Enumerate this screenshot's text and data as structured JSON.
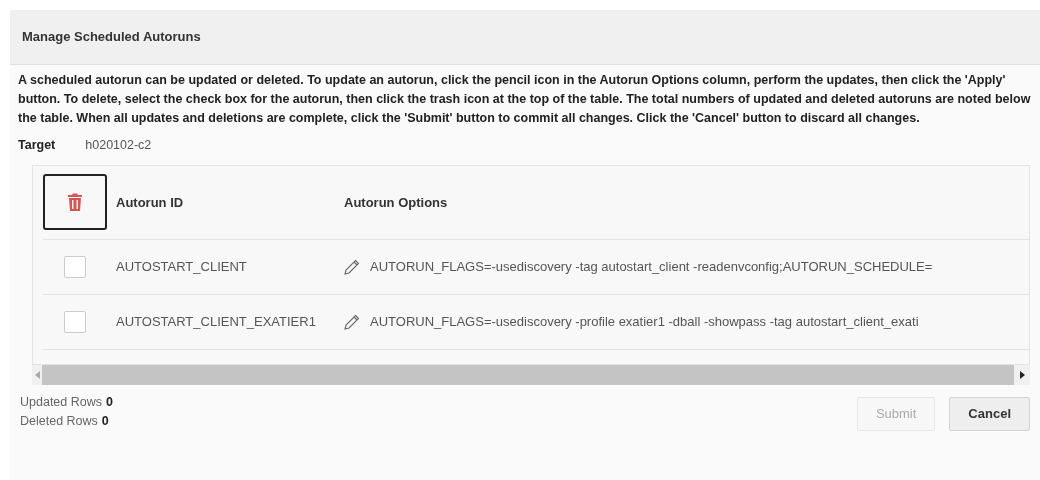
{
  "dialog": {
    "title": "Manage Scheduled Autoruns"
  },
  "instructions": "A scheduled autorun can be updated or deleted. To update an autorun, click the pencil icon in the Autorun Options column, perform the updates, then click the 'Apply' button. To delete, select the check box for the autorun, then click the trash icon at the top of the table. The total numbers of updated and deleted autoruns are noted below the table. When all updates and deletions are complete, click the 'Submit' button to commit all changes. Click the 'Cancel' button to discard all changes.",
  "target": {
    "label": "Target",
    "value": "h020102-c2"
  },
  "table": {
    "columns": [
      "Autorun ID",
      "Autorun Options"
    ],
    "rows": [
      {
        "checked": false,
        "id": "AUTOSTART_CLIENT",
        "options": "AUTORUN_FLAGS=-usediscovery -tag autostart_client -readenvconfig;AUTORUN_SCHEDULE="
      },
      {
        "checked": false,
        "id": "AUTOSTART_CLIENT_EXATIER1",
        "options": "AUTORUN_FLAGS=-usediscovery -profile exatier1 -dball -showpass -tag autostart_client_exati"
      }
    ]
  },
  "summary": [
    {
      "label": "Updated Rows",
      "value": "0"
    },
    {
      "label": "Deleted Rows",
      "value": "0"
    }
  ],
  "buttons": [
    {
      "label": "Submit",
      "disabled": true
    },
    {
      "label": "Cancel",
      "disabled": false
    }
  ]
}
